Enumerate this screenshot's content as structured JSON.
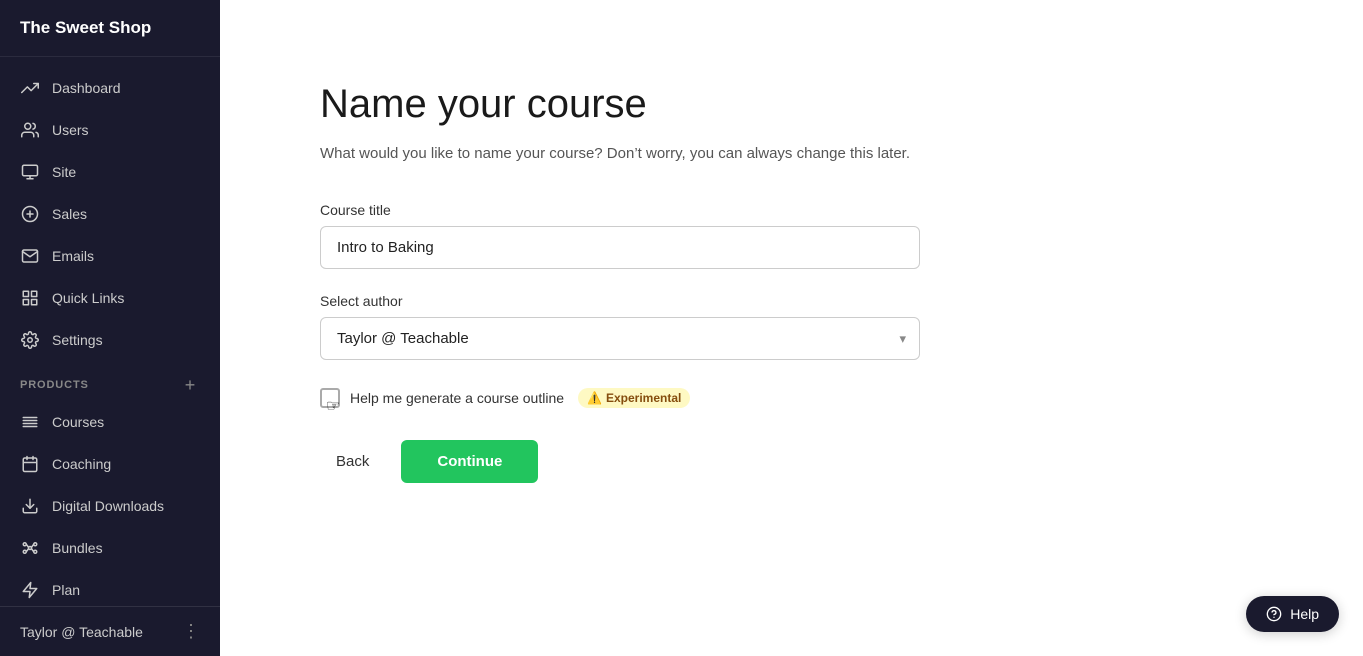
{
  "sidebar": {
    "logo": "The Sweet Shop",
    "nav_items": [
      {
        "id": "dashboard",
        "label": "Dashboard",
        "icon": "trending-up"
      },
      {
        "id": "users",
        "label": "Users",
        "icon": "users"
      },
      {
        "id": "site",
        "label": "Site",
        "icon": "monitor"
      },
      {
        "id": "sales",
        "label": "Sales",
        "icon": "dollar"
      },
      {
        "id": "emails",
        "label": "Emails",
        "icon": "mail"
      },
      {
        "id": "quick-links",
        "label": "Quick Links",
        "icon": "grid"
      },
      {
        "id": "settings",
        "label": "Settings",
        "icon": "settings"
      }
    ],
    "products_section": "PRODUCTS",
    "product_items": [
      {
        "id": "courses",
        "label": "Courses",
        "icon": "courses"
      },
      {
        "id": "coaching",
        "label": "Coaching",
        "icon": "coaching"
      },
      {
        "id": "digital-downloads",
        "label": "Digital Downloads",
        "icon": "digital-downloads"
      },
      {
        "id": "bundles",
        "label": "Bundles",
        "icon": "bundles"
      },
      {
        "id": "plan",
        "label": "Plan",
        "icon": "plan"
      }
    ],
    "footer_user": "Taylor @ Teachable"
  },
  "form": {
    "title": "Name your course",
    "subtitle": "What would you like to name your course? Don’t worry, you can always change this later.",
    "course_title_label": "Course title",
    "course_title_value": "Intro to Baking",
    "course_title_placeholder": "Intro to Baking",
    "select_author_label": "Select author",
    "selected_author": "Taylor @ Teachable",
    "author_options": [
      "Taylor @ Teachable"
    ],
    "checkbox_label": "Help me generate a course outline",
    "experimental_label": "Experimental",
    "back_button": "Back",
    "continue_button": "Continue"
  },
  "help": {
    "label": "Help"
  },
  "colors": {
    "sidebar_bg": "#1a1a2e",
    "continue_green": "#22c55e",
    "experimental_bg": "#fef9c3",
    "experimental_text": "#854d0e"
  }
}
